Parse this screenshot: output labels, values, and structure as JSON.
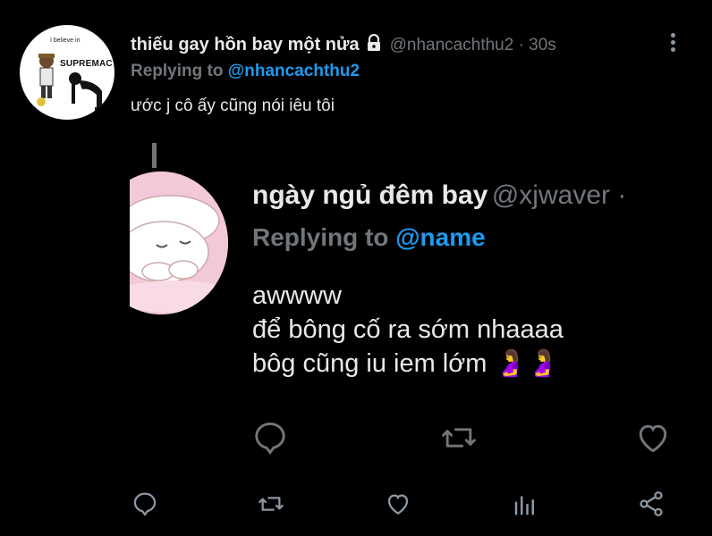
{
  "tweet": {
    "avatar_text_small": "I believe in",
    "avatar_text_big": "SUPREMACY",
    "display_name": "thiếu gay hồn bay một nửa",
    "handle_time": "@nhancachthu2 · 30s",
    "replying_prefix": "Replying to",
    "replying_to": "@nhancachthu2",
    "text": "ước j cô ấy cũng nói iêu tôi"
  },
  "embedded": {
    "display_name": "ngày ngủ đêm bay",
    "handle": "@xjwaver ·",
    "replying_prefix": "Replying to",
    "replying_to": "@name",
    "lines": [
      "awwww",
      "để bông cố ra sớm nhaaaa",
      "bôg cũng iu iem lớm 🤰🤰"
    ]
  },
  "icons": {
    "lock": "lock-icon",
    "more": "more-vertical-icon",
    "reply": "reply-icon",
    "retweet": "retweet-icon",
    "like": "like-icon",
    "views": "views-icon",
    "share": "share-icon"
  },
  "colors": {
    "background": "#000000",
    "text": "#e7e9ea",
    "muted": "#71767b",
    "accent": "#1d9bf0"
  }
}
